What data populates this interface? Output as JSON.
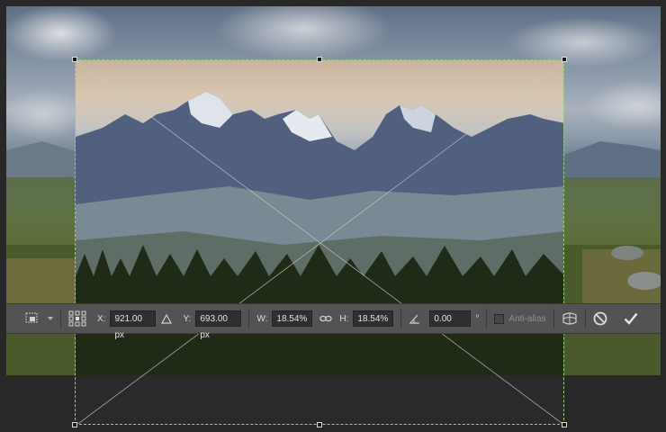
{
  "toolbar": {
    "x_label": "X:",
    "x_value": "921.00 px",
    "y_label": "Y:",
    "y_value": "693.00 px",
    "w_label": "W:",
    "w_value": "18.54%",
    "h_label": "H:",
    "h_value": "18.54%",
    "angle_value": "0.00",
    "degree_symbol": "°",
    "antialias_label": "Anti-alias",
    "icons": [
      "transform-presets-icon",
      "reference-point-icon",
      "delta-icon",
      "link-icon",
      "angle-icon",
      "warp-icon",
      "cancel-icon",
      "commit-icon"
    ]
  },
  "colors": {
    "toolbar_bg": "#535353",
    "crop_border": "#8fd36a",
    "canvas_bg": "#282828"
  }
}
